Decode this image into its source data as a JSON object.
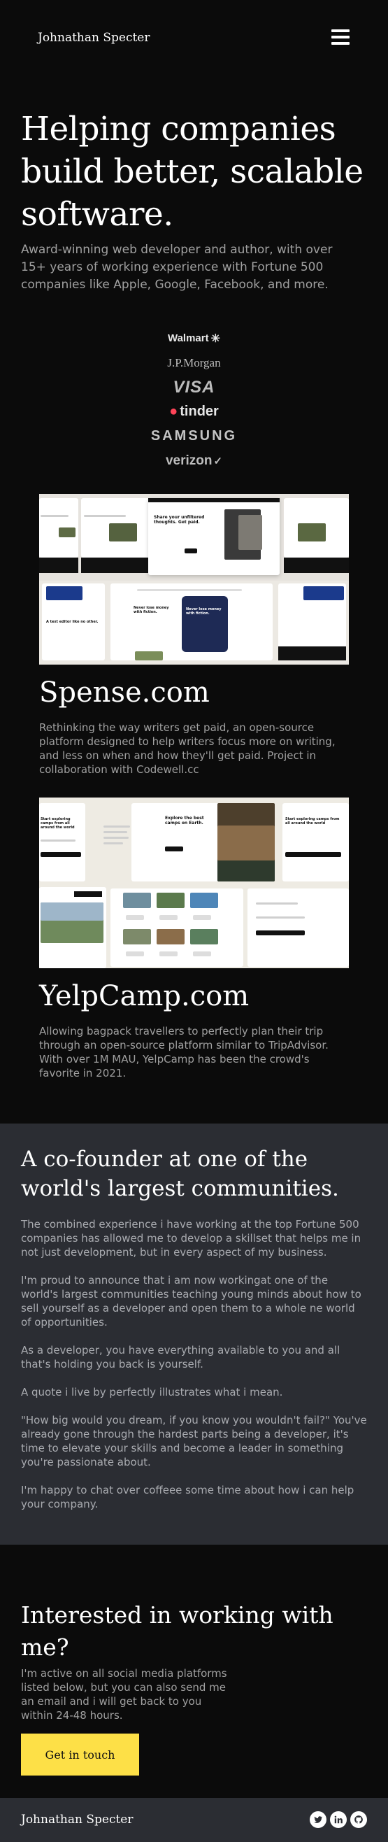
{
  "header": {
    "brand": "Johnathan Specter",
    "menu_icon": "hamburger-menu-icon"
  },
  "hero": {
    "title": "Helping companies build better, scalable software.",
    "subtitle": "Award-winning web developer and author, with over 15+ years of working experience with Fortune 500 companies like Apple, Google, Facebook, and more."
  },
  "logos": {
    "walmart": "Walmart",
    "jpmorgan": "J.P.Morgan",
    "visa": "VISA",
    "tinder": "tinder",
    "samsung": "SAMSUNG",
    "verizon": "verizon"
  },
  "projects": [
    {
      "title": "Spense.com",
      "description": "Rethinking the way writers get paid, an open-source platform designed to help writers focus more on writing, and less on when and how they'll get paid. Project in collaboration with Codewell.cc",
      "mock": {
        "headline": "Share your unfiltered thoughts. Get paid.",
        "card_title": "Never lose money with fiction.",
        "card_title_2": "Never lose money with fiction.",
        "banner": "A text editor like no other."
      }
    },
    {
      "title": "YelpCamp.com",
      "description": "Allowing bagpack travellers to perfectly plan their trip through an open-source platform similar to TripAdvisor. With over 1M MAU, YelpCamp has been the crowd's favorite in 2021.",
      "mock": {
        "headline": "Explore the best camps on Earth.",
        "side_heading": "Start exploring camps from all around the world",
        "side_heading_2": "Start exploring camps from all around the world"
      }
    }
  ],
  "cofounder": {
    "title": "A co-founder at one of the world's largest communities.",
    "paragraphs": [
      "The combined experience i have working at the top Fortune 500 companies has allowed me to develop a skillset that helps me in not just development, but in every aspect of my business.",
      "I'm proud to announce that i am now workingat one of the world's largest communities teaching young minds about how to sell yourself as a developer and open them to a whole ne world of opportunities.",
      "As a developer, you have everything available to you and all that's holding you back is yourself.",
      "A quote i live by perfectly illustrates what i mean.",
      "\"How big would you dream, if you know you wouldn't fail?\" You've already gone through the hardest parts being a developer, it's time to elevate your skills and become a leader in something you're passionate about.",
      "I'm happy to chat over coffeee some time about how i can help your company."
    ]
  },
  "contact": {
    "title": "Interested in working with me?",
    "text": "I'm active on all social media platforms listed below, but you can also send me an email and i will get back to you within 24-48 hours.",
    "button": "Get in touch",
    "button_color": "#fde047"
  },
  "footer": {
    "brand": "Johnathan Specter",
    "social_icons": [
      "twitter-icon",
      "linkedin-icon",
      "github-icon"
    ]
  }
}
